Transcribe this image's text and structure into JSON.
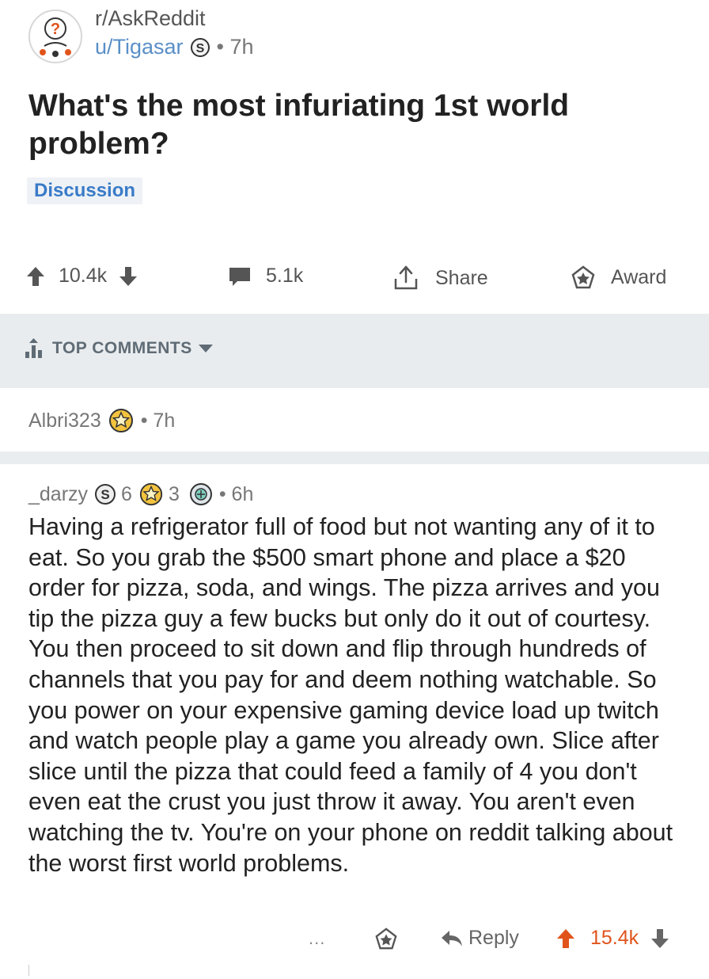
{
  "post": {
    "subreddit": "r/AskReddit",
    "author": "u/Tigasar",
    "time": "• 7h",
    "title": "What's the most infuriating 1st world problem?",
    "flair": "Discussion",
    "score": "10.4k",
    "comments": "5.1k",
    "share_label": "Share",
    "award_label": "Award"
  },
  "sort": {
    "label": "TOP COMMENTS"
  },
  "collapsed_comment": {
    "author": "Albri323",
    "time": "• 7h"
  },
  "comment": {
    "author": "_darzy",
    "silver_count": "6",
    "gold_count": "3",
    "time": "• 6h",
    "body": "Having a refrigerator full of food but not wanting any of it to eat. So you grab the $500 smart phone and place a $20 order for pizza, soda, and wings. The pizza arrives and you tip the pizza guy a few bucks but only do it out of courtesy. You then proceed to sit down and flip through hundreds of channels that you pay for and deem nothing watchable. So you power on your expensive gaming device load up twitch and watch people play a game you already own. Slice after slice until the pizza that could feed a family of 4 you don't even eat the crust you just throw it away. You aren't even watching the tv. You're on your phone on reddit talking about the worst first world problems.",
    "more": "...",
    "reply_label": "Reply",
    "score": "15.4k"
  },
  "colors": {
    "link_blue": "#5a8fc7",
    "upvote_orange": "#e0541c",
    "bar_gray": "#e9ecee"
  },
  "icons": [
    "askreddit-avatar-icon",
    "silver-award-icon",
    "gold-award-icon",
    "platinum-award-icon",
    "upvote-icon",
    "downvote-icon",
    "comment-icon",
    "share-icon",
    "award-icon",
    "top-sort-icon",
    "reply-icon",
    "more-icon"
  ]
}
